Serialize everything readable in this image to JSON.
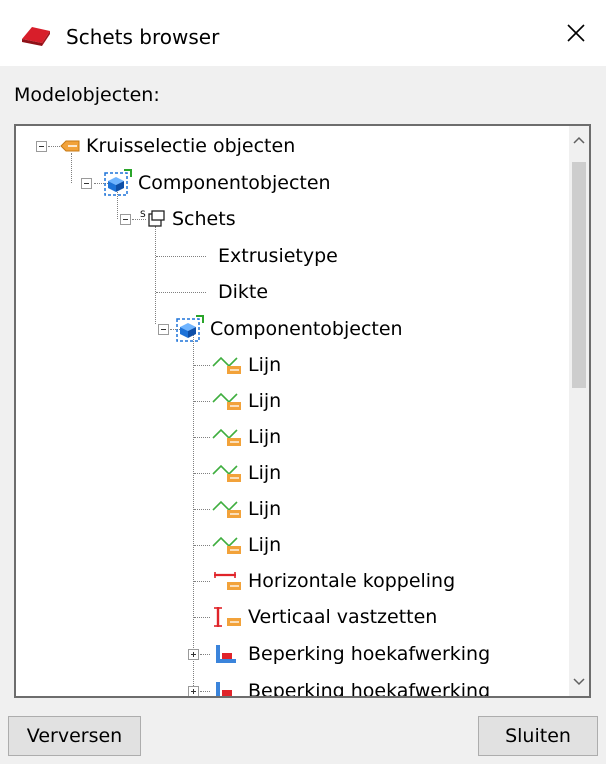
{
  "window": {
    "title": "Schets browser",
    "close_glyph": "✕"
  },
  "section_label": "Modelobjecten:",
  "tree": [
    {
      "label": "Kruisselectie objecten",
      "icon": "tag-icon"
    },
    {
      "label": "Componentobjecten",
      "icon": "component-icon"
    },
    {
      "label": "Schets",
      "icon": "sketch-icon"
    },
    {
      "label": "Extrusietype",
      "icon": ""
    },
    {
      "label": "Dikte",
      "icon": ""
    },
    {
      "label": "Componentobjecten",
      "icon": "component-icon"
    },
    {
      "label": "Lijn",
      "icon": "line-icon"
    },
    {
      "label": "Lijn",
      "icon": "line-icon"
    },
    {
      "label": "Lijn",
      "icon": "line-icon"
    },
    {
      "label": "Lijn",
      "icon": "line-icon"
    },
    {
      "label": "Lijn",
      "icon": "line-icon"
    },
    {
      "label": "Lijn",
      "icon": "line-icon"
    },
    {
      "label": "Horizontale koppeling",
      "icon": "horizontal-constraint-icon"
    },
    {
      "label": "Verticaal vastzetten",
      "icon": "vertical-constraint-icon"
    },
    {
      "label": "Beperking hoekafwerking",
      "icon": "chamfer-constraint-icon"
    },
    {
      "label": "Beperking hoekafwerking",
      "icon": "chamfer-constraint-icon"
    }
  ],
  "buttons": {
    "refresh": "Verversen",
    "close": "Sluiten"
  },
  "colors": {
    "accent": "#1e73d8",
    "tag_orange": "#f2a23a",
    "constraint_red": "#e0242a"
  }
}
